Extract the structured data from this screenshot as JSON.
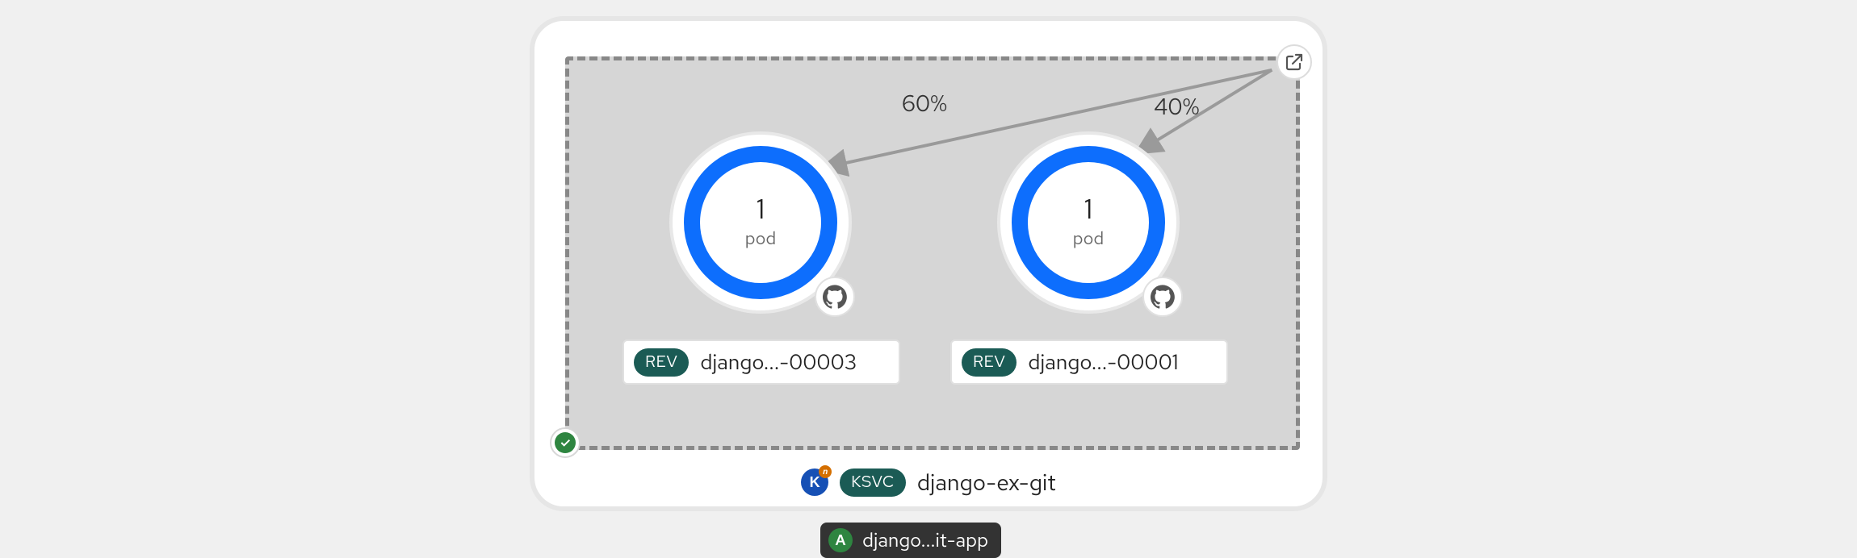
{
  "traffic": {
    "left_percent": "60%",
    "right_percent": "40%"
  },
  "pods": {
    "left": {
      "count": "1",
      "label": "pod"
    },
    "right": {
      "count": "1",
      "label": "pod"
    }
  },
  "revisions": {
    "badge_label": "REV",
    "left_name": "django...-00003",
    "right_name": "django...-00001"
  },
  "service": {
    "badge_label": "KSVC",
    "name": "django-ex-git"
  },
  "application": {
    "badge_letter": "A",
    "name": "django...it-app"
  },
  "status": "success",
  "colors": {
    "ring": "#0d6efd",
    "pill": "#1b5b55",
    "success": "#2e8540",
    "dashed_bg": "#d6d6d6",
    "dashed_border": "#888888"
  }
}
